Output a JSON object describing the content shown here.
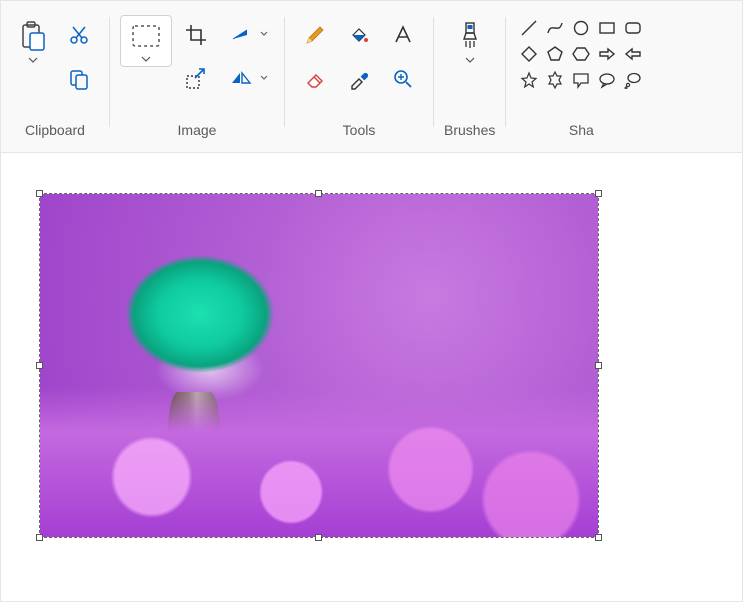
{
  "ribbon": {
    "clipboard": {
      "label": "Clipboard"
    },
    "image": {
      "label": "Image"
    },
    "tools": {
      "label": "Tools"
    },
    "brushes": {
      "label": "Brushes"
    },
    "shapes": {
      "label": "Sha"
    }
  },
  "icons": {
    "paste": "paste",
    "cut": "cut",
    "copy": "copy",
    "select": "select",
    "crop": "crop",
    "resize": "resize",
    "rotate_left": "rotate",
    "flip": "flip",
    "pencil": "pencil",
    "fill": "fill",
    "text": "text",
    "eraser": "eraser",
    "picker": "color-picker",
    "magnifier": "magnifier",
    "brush": "brush"
  },
  "shapes": [
    "line",
    "curve",
    "circle",
    "rectangle",
    "rounded-rect",
    "diamond",
    "pentagon",
    "hexagon",
    "arrow-right",
    "arrow-left",
    "star-5",
    "star-6",
    "speech-rect",
    "speech-oval",
    "thought"
  ],
  "colors": {
    "outline": "#333333",
    "accent_blue": "#0a63c2",
    "accent_orange": "#e59a1b",
    "accent_red": "#d6433b"
  }
}
